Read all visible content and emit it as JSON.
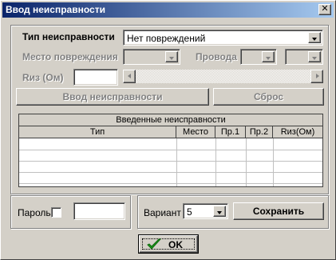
{
  "window": {
    "title": "Ввод неисправности",
    "close_glyph": "✕"
  },
  "fault": {
    "type_label": "Тип неисправности",
    "type_value": "Нет повреждений",
    "place_label": "Место повреждения",
    "place_value": "",
    "wires_label": "Провода",
    "wire1_value": "",
    "wire2_value": "",
    "r_label": "Rиз (Ом)",
    "r_value": "",
    "enter_button": "Ввод неисправности",
    "reset_button": "Сброс"
  },
  "table": {
    "caption": "Введенные неисправности",
    "columns": [
      "Тип",
      "Место",
      "Пр.1",
      "Пр.2",
      "Rиз(Ом)"
    ],
    "rows": []
  },
  "bottom": {
    "password_label": "Пароль",
    "password_checked": false,
    "password_value": "",
    "variant_label": "Вариант",
    "variant_value": "5",
    "save_button": "Сохранить"
  },
  "ok_button": {
    "label": "OK",
    "icon": "checkmark-icon",
    "icon_color": "#1a9a1a"
  }
}
